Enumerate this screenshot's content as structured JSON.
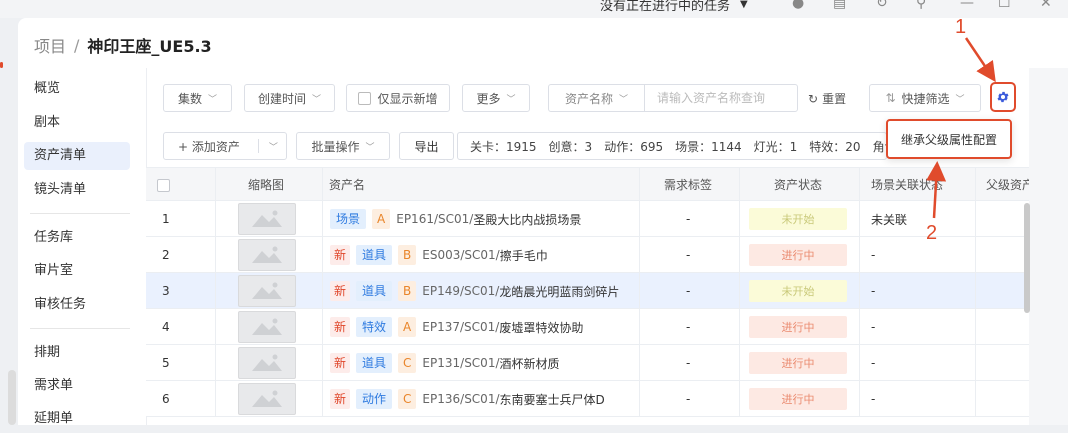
{
  "system_bar": {
    "task_status": "没有正在进行中的任务"
  },
  "breadcrumb": {
    "parent": "项目",
    "separator": "/",
    "current": "神印王座_UE5.3"
  },
  "sidebar": {
    "items": [
      {
        "label": "概览"
      },
      {
        "label": "剧本"
      },
      {
        "label": "资产清单"
      },
      {
        "label": "镜头清单"
      },
      {
        "label": "任务库"
      },
      {
        "label": "审片室"
      },
      {
        "label": "审核任务"
      },
      {
        "label": "排期"
      },
      {
        "label": "需求单"
      },
      {
        "label": "延期单"
      }
    ],
    "active_index": 2
  },
  "toolbar": {
    "episodes": "集数",
    "created_time": "创建时间",
    "only_new": "仅显示新增",
    "more": "更多",
    "asset_name_select": "资产名称",
    "search_placeholder": "请输入资产名称查询",
    "reset": "重置",
    "quick_filter": "快捷筛选"
  },
  "toolbar2": {
    "add_asset": "+ 添加资产",
    "batch": "批量操作",
    "export": "导出"
  },
  "stats": {
    "items": [
      "关卡：1915",
      "创意：3",
      "动作：695",
      "场景：1144",
      "灯光：1",
      "特效：20",
      "角色"
    ]
  },
  "popup": {
    "label": "继承父级属性配置"
  },
  "table": {
    "headers": {
      "thumb": "缩略图",
      "name": "资产名",
      "tags": "需求标签",
      "status": "资产状态",
      "scene": "场景关联状态",
      "parent": "父级资产"
    },
    "rows": [
      {
        "idx": "1",
        "new": "",
        "type": "场景",
        "grade": "A",
        "code": "EP161/SC01/",
        "name": "圣殿大比内战损场景",
        "tags": "-",
        "status": "未开始",
        "scene": "未关联"
      },
      {
        "idx": "2",
        "new": "新",
        "type": "道具",
        "grade": "B",
        "code": "ES003/SC01/",
        "name": "擦手毛巾",
        "tags": "-",
        "status": "进行中",
        "scene": "-"
      },
      {
        "idx": "3",
        "new": "新",
        "type": "道具",
        "grade": "B",
        "code": "EP149/SC01/",
        "name": "龙皓晨光明蓝雨剑碎片",
        "tags": "-",
        "status": "未开始",
        "scene": "-"
      },
      {
        "idx": "4",
        "new": "新",
        "type": "特效",
        "grade": "A",
        "code": "EP137/SC01/",
        "name": "废墟罩特效协助",
        "tags": "-",
        "status": "进行中",
        "scene": "-"
      },
      {
        "idx": "5",
        "new": "新",
        "type": "道具",
        "grade": "C",
        "code": "EP131/SC01/",
        "name": "酒杯新材质",
        "tags": "-",
        "status": "进行中",
        "scene": "-"
      },
      {
        "idx": "6",
        "new": "新",
        "type": "动作",
        "grade": "C",
        "code": "EP136/SC01/",
        "name": "东南要塞士兵尸体D",
        "tags": "-",
        "status": "进行中",
        "scene": "-"
      }
    ]
  },
  "annotations": {
    "one": "1",
    "two": "2"
  },
  "colors": {
    "accent": "#3b5bdb",
    "annotation": "#e04b2c",
    "selected_row": "#eaf1fe"
  }
}
